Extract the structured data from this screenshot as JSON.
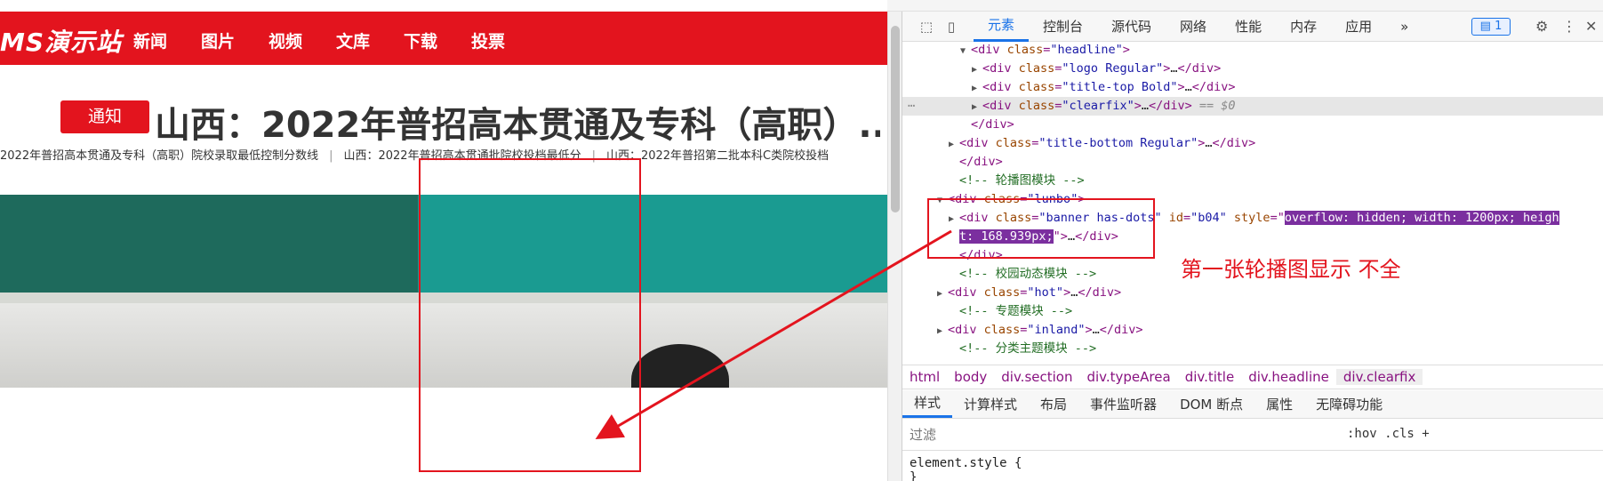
{
  "site": {
    "logo": "MS演示站",
    "nav": [
      "新闻",
      "图片",
      "视频",
      "文库",
      "下载",
      "投票"
    ],
    "badge": "通知",
    "headline": "山西：2022年普招高本贯通及专科（高职）...",
    "sublinks": [
      "2022年普招高本贯通及专科（高职）院校录取最低控制分数线",
      "山西：2022年普招高本贯通批院校投档最低分",
      "山西：2022年普招第二批本科C类院校投档"
    ],
    "sublink_sep": "|"
  },
  "annotation": {
    "note": "第一张轮播图显示 不全"
  },
  "devtools": {
    "tabs": [
      "元素",
      "控制台",
      "源代码",
      "网络",
      "性能",
      "内存",
      "应用"
    ],
    "more_tabs": "»",
    "messages_badge": "1",
    "dom_lines": [
      {
        "indent": 5,
        "tri": "▼",
        "parts": [
          [
            "tag",
            "<div "
          ],
          [
            "attr",
            "class"
          ],
          [
            "tag",
            "="
          ],
          [
            "val",
            "\"headline\""
          ],
          [
            "tag",
            ">"
          ]
        ]
      },
      {
        "indent": 6,
        "tri": "▶",
        "parts": [
          [
            "tag",
            "<div "
          ],
          [
            "attr",
            "class"
          ],
          [
            "tag",
            "="
          ],
          [
            "val",
            "\"logo Regular\""
          ],
          [
            "tag",
            ">"
          ],
          [
            "txt",
            "…"
          ],
          [
            "tag",
            "</div>"
          ]
        ]
      },
      {
        "indent": 6,
        "tri": "▶",
        "parts": [
          [
            "tag",
            "<div "
          ],
          [
            "attr",
            "class"
          ],
          [
            "tag",
            "="
          ],
          [
            "val",
            "\"title-top Bold\""
          ],
          [
            "tag",
            ">"
          ],
          [
            "txt",
            "…"
          ],
          [
            "tag",
            "</div>"
          ]
        ]
      },
      {
        "indent": 6,
        "tri": "▶",
        "sel": true,
        "parts": [
          [
            "tag",
            "<div "
          ],
          [
            "attr",
            "class"
          ],
          [
            "tag",
            "="
          ],
          [
            "val",
            "\"clearfix\""
          ],
          [
            "tag",
            ">"
          ],
          [
            "txt",
            "…"
          ],
          [
            "tag",
            "</div>"
          ],
          [
            "dollar",
            " == $0"
          ]
        ]
      },
      {
        "indent": 5,
        "tri": "",
        "parts": [
          [
            "tag",
            "</div>"
          ]
        ]
      },
      {
        "indent": 4,
        "tri": "▶",
        "parts": [
          [
            "tag",
            "<div "
          ],
          [
            "attr",
            "class"
          ],
          [
            "tag",
            "="
          ],
          [
            "val",
            "\"title-bottom Regular\""
          ],
          [
            "tag",
            ">"
          ],
          [
            "txt",
            "…"
          ],
          [
            "tag",
            "</div>"
          ]
        ]
      },
      {
        "indent": 4,
        "tri": "",
        "parts": [
          [
            "tag",
            "</div>"
          ]
        ]
      },
      {
        "indent": 4,
        "tri": "",
        "parts": [
          [
            "cmt",
            "<!-- 轮播图模块 -->"
          ]
        ]
      },
      {
        "indent": 3,
        "tri": "▼",
        "parts": [
          [
            "tag",
            "<div "
          ],
          [
            "attr",
            "class"
          ],
          [
            "tag",
            "="
          ],
          [
            "val",
            "\"lunbo\""
          ],
          [
            "tag",
            ">"
          ]
        ]
      },
      {
        "indent": 4,
        "tri": "▶",
        "parts": [
          [
            "tag",
            "<div "
          ],
          [
            "attr",
            "class"
          ],
          [
            "tag",
            "="
          ],
          [
            "val",
            "\"banner has-dots\""
          ],
          [
            "txt",
            " "
          ],
          [
            "attr",
            "id"
          ],
          [
            "tag",
            "="
          ],
          [
            "val",
            "\"b04\""
          ],
          [
            "txt",
            " "
          ],
          [
            "attr",
            "style"
          ],
          [
            "tag",
            "=\""
          ],
          [
            "hl",
            "overflow: hidden; width: 1200px; heigh"
          ]
        ]
      },
      {
        "indent": 4,
        "tri": "",
        "parts": [
          [
            "hl",
            "t: 168.939px;"
          ],
          [
            "tag",
            "\">"
          ],
          [
            "txt",
            "…"
          ],
          [
            "tag",
            "</div>"
          ]
        ]
      },
      {
        "indent": 4,
        "tri": "",
        "parts": [
          [
            "tag",
            "</div>"
          ]
        ]
      },
      {
        "indent": 4,
        "tri": "",
        "parts": [
          [
            "cmt",
            "<!-- 校园动态模块 -->"
          ]
        ]
      },
      {
        "indent": 3,
        "tri": "▶",
        "parts": [
          [
            "tag",
            "<div "
          ],
          [
            "attr",
            "class"
          ],
          [
            "tag",
            "="
          ],
          [
            "val",
            "\"hot\""
          ],
          [
            "tag",
            ">"
          ],
          [
            "txt",
            "…"
          ],
          [
            "tag",
            "</div>"
          ]
        ]
      },
      {
        "indent": 4,
        "tri": "",
        "parts": [
          [
            "cmt",
            "<!-- 专题模块 -->"
          ]
        ]
      },
      {
        "indent": 3,
        "tri": "▶",
        "parts": [
          [
            "tag",
            "<div "
          ],
          [
            "attr",
            "class"
          ],
          [
            "tag",
            "="
          ],
          [
            "val",
            "\"inland\""
          ],
          [
            "tag",
            ">"
          ],
          [
            "txt",
            "…"
          ],
          [
            "tag",
            "</div>"
          ]
        ]
      },
      {
        "indent": 4,
        "tri": "",
        "parts": [
          [
            "cmt",
            "<!-- 分类主题模块 -->"
          ]
        ]
      }
    ],
    "breadcrumbs": [
      "html",
      "body",
      "div.section",
      "div.typeArea",
      "div.title",
      "div.headline",
      "div.clearfix"
    ],
    "subtabs": [
      "样式",
      "计算样式",
      "布局",
      "事件监听器",
      "DOM 断点",
      "属性",
      "无障碍功能"
    ],
    "filter_placeholder": "过滤",
    "filter_buttons": ":hov  .cls  +",
    "style_rule": "element.style {",
    "style_rule_end": "}"
  },
  "colors": {
    "brand_red": "#e3141e",
    "devtools_blue": "#1a73e8",
    "highlight_purple": "#7b2f9f"
  }
}
